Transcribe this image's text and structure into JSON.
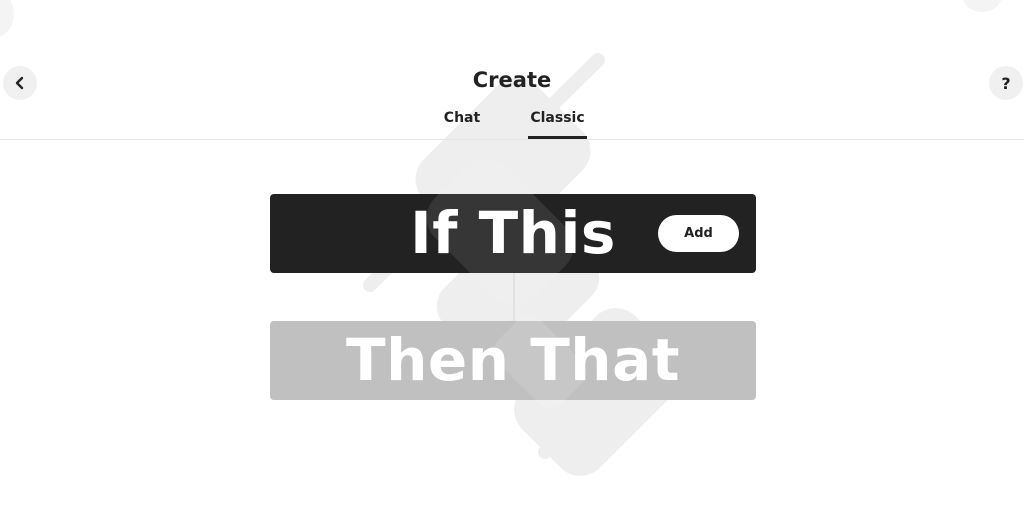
{
  "header": {
    "title": "Create",
    "back_icon": "chevron-left-icon",
    "help_label": "?"
  },
  "tabs": [
    {
      "label": "Chat",
      "active": false
    },
    {
      "label": "Classic",
      "active": true
    }
  ],
  "applet": {
    "trigger_label": "If This",
    "trigger_add_label": "Add",
    "action_label": "Then That"
  },
  "colors": {
    "trigger_block": "#222222",
    "action_block_disabled": "#c0c0c0",
    "background_art": "#eeeeee",
    "text_primary": "#222222"
  }
}
